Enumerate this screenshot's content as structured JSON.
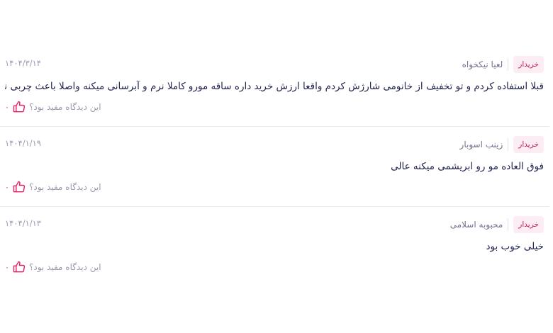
{
  "reviews": [
    {
      "author": "لعیا نیکخواه",
      "badge": "خریدار",
      "date": "۱۴۰۴/۳/۱۴",
      "text": "قبلا استفاده کردم و تو تخفیف از خانومی شارژش کردم واقعا ارزش خرید داره ساقه مورو کاملا نرم و آبرسانی میکنه واصلا باعث چربی نمیشه",
      "helpful_question": "این دیدگاه مفید بود؟",
      "likes": "۰"
    },
    {
      "author": "زینب اسوبار",
      "badge": "خریدار",
      "date": "۱۴۰۴/۱/۱۹",
      "text": "فوق العاده مو رو ابریشمی میکنه عالی",
      "helpful_question": "این دیدگاه مفید بود؟",
      "likes": "۰"
    },
    {
      "author": "محبوبه اسلامی",
      "badge": "خریدار",
      "date": "۱۴۰۴/۱/۱۳",
      "text": "خیلی خوب بود",
      "helpful_question": "این دیدگاه مفید بود؟",
      "likes": "۰"
    }
  ],
  "icons": {
    "helpful": "thumbs-up-icon"
  },
  "colors": {
    "accent": "#e91e63",
    "badge_bg": "#fcecf3",
    "badge_text": "#c2185b",
    "text": "#23254e",
    "muted": "#9a9bb0"
  }
}
